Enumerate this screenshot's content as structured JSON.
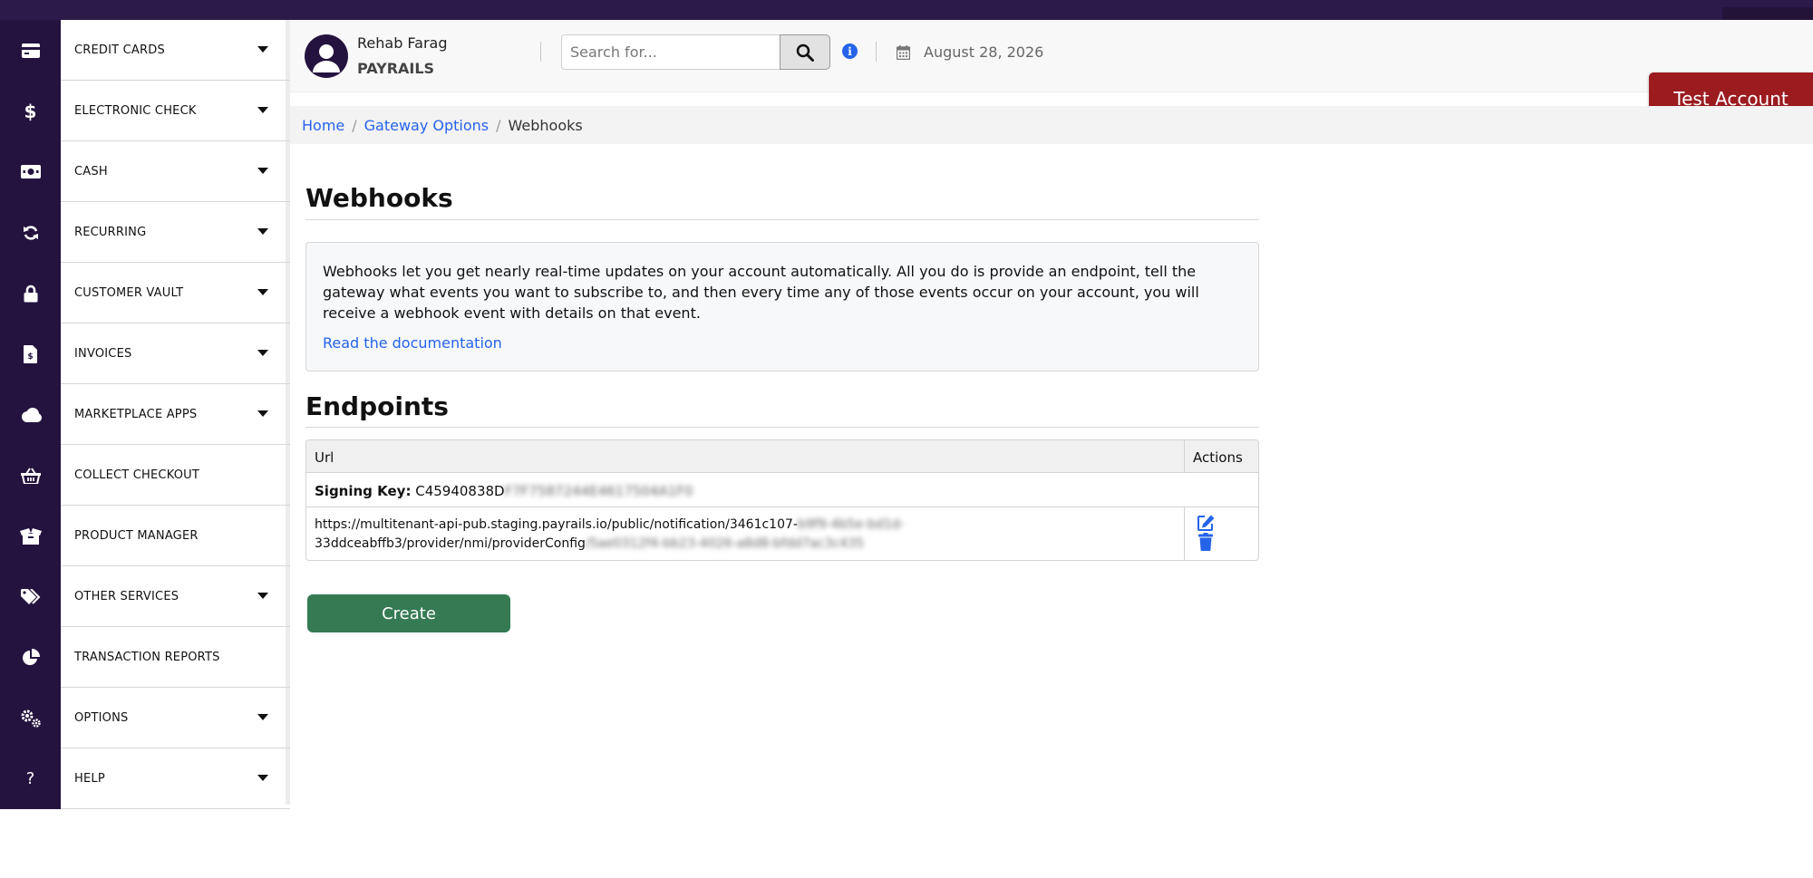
{
  "sidebar": {
    "items": [
      {
        "label": "CREDIT CARDS",
        "icon": "credit-card-icon",
        "has_caret": true
      },
      {
        "label": "ELECTRONIC CHECK",
        "icon": "dollar-icon",
        "has_caret": true
      },
      {
        "label": "CASH",
        "icon": "cash-icon",
        "has_caret": true
      },
      {
        "label": "RECURRING",
        "icon": "refresh-icon",
        "has_caret": true
      },
      {
        "label": "CUSTOMER VAULT",
        "icon": "lock-icon",
        "has_caret": true
      },
      {
        "label": "INVOICES",
        "icon": "invoice-icon",
        "has_caret": true
      },
      {
        "label": "MARKETPLACE APPS",
        "icon": "cloud-icon",
        "has_caret": true
      },
      {
        "label": "COLLECT CHECKOUT",
        "icon": "basket-icon",
        "has_caret": false
      },
      {
        "label": "PRODUCT MANAGER",
        "icon": "box-icon",
        "has_caret": false
      },
      {
        "label": "OTHER SERVICES",
        "icon": "tags-icon",
        "has_caret": true
      },
      {
        "label": "TRANSACTION REPORTS",
        "icon": "pie-chart-icon",
        "has_caret": false
      },
      {
        "label": "OPTIONS",
        "icon": "gears-icon",
        "has_caret": true
      },
      {
        "label": "HELP",
        "icon": "question-icon",
        "has_caret": true
      }
    ]
  },
  "header": {
    "user_name": "Rehab Farag",
    "org_name": "PAYRAILS",
    "search_placeholder": "Search for...",
    "date": "August 28, 2026"
  },
  "test_account_label": "Test Account",
  "breadcrumb": {
    "home": "Home",
    "gateway_options": "Gateway Options",
    "current": "Webhooks"
  },
  "webhooks": {
    "title": "Webhooks",
    "description": "Webhooks let you get nearly real-time updates on your account automatically. All you do is provide an endpoint, tell the gateway what events you want to subscribe to, and then every time any of those events occur on your account, you will receive a webhook event with details on that event.",
    "doc_link": "Read the documentation"
  },
  "endpoints": {
    "title": "Endpoints",
    "col_url": "Url",
    "col_actions": "Actions",
    "signing_key_label": "Signing Key:",
    "signing_key_visible": "C45940838D",
    "signing_key_redacted": "F7F7587244E4617504A1F0",
    "url_line1_visible": "https://multitenant-api-pub.staging.payrails.io/public/notification/3461c107-",
    "url_line1_redacted": "b9f9-4b5e-bd1d-",
    "url_line2_visible": "33ddceabffb3/provider/nmi/providerConfig",
    "url_line2_redacted": "/5ae0312f4-bb23-4026-a8d8-bfdd7ac3c435"
  },
  "create_label": "Create",
  "colors": {
    "sidebar_icon_bg": "#24133f",
    "link": "#2563eb",
    "create_button": "#357a52",
    "test_account": "#9b1b1f"
  }
}
